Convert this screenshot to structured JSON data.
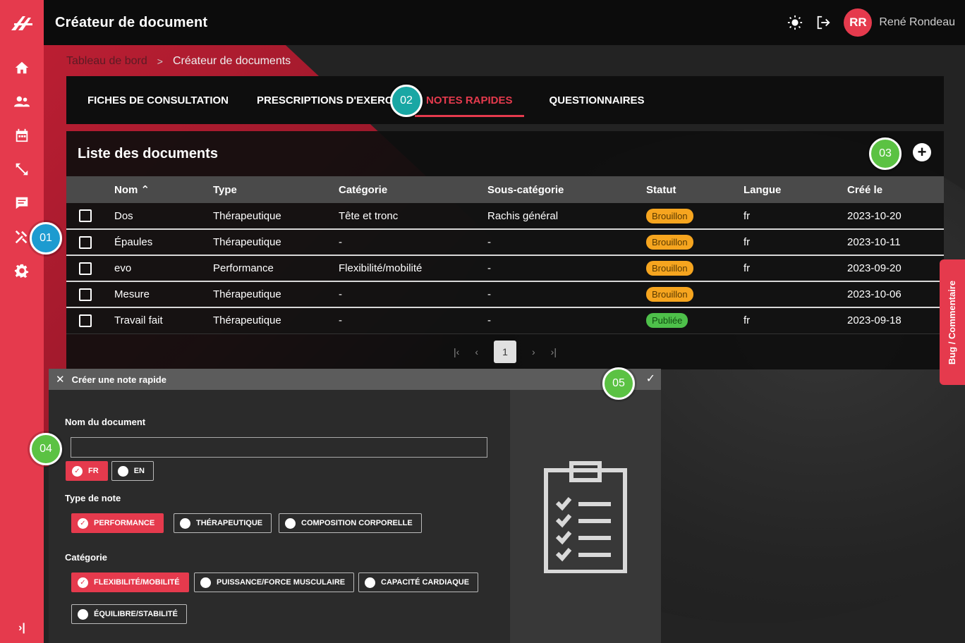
{
  "app": {
    "title": "Créateur de document"
  },
  "user": {
    "initials": "RR",
    "name": "René Rondeau"
  },
  "breadcrumb": {
    "previous": "Tableau de bord",
    "separator": ">",
    "current": "Créateur de documents"
  },
  "tabs": [
    {
      "label": "FICHES DE CONSULTATION"
    },
    {
      "label": "PRESCRIPTIONS D'EXERCICES"
    },
    {
      "label": "NOTES RAPIDES"
    },
    {
      "label": "QUESTIONNAIRES"
    }
  ],
  "markers": {
    "m1": "01",
    "m2": "02",
    "m3": "03",
    "m4": "04",
    "m5": "05"
  },
  "list": {
    "title": "Liste des documents",
    "add_label": "+",
    "columns": [
      "Nom ⌃",
      "Type",
      "Catégorie",
      "Sous-catégorie",
      "Statut",
      "Langue",
      "Créé le"
    ],
    "rows": [
      {
        "name": "Dos",
        "type": "Thérapeutique",
        "category": "Tête et tronc",
        "subcategory": "Rachis général",
        "status": "Brouillon",
        "lang": "fr",
        "created": "2023-10-20"
      },
      {
        "name": "Épaules",
        "type": "Thérapeutique",
        "category": "-",
        "subcategory": "-",
        "status": "Brouillon",
        "lang": "fr",
        "created": "2023-10-11"
      },
      {
        "name": "evo",
        "type": "Performance",
        "category": "Flexibilité/mobilité",
        "subcategory": "-",
        "status": "Brouillon",
        "lang": "fr",
        "created": "2023-09-20"
      },
      {
        "name": "Mesure",
        "type": "Thérapeutique",
        "category": "-",
        "subcategory": "-",
        "status": "Brouillon",
        "lang": "",
        "created": "2023-10-06"
      },
      {
        "name": "Travail fait",
        "type": "Thérapeutique",
        "category": "-",
        "subcategory": "-",
        "status": "Publiée",
        "lang": "fr",
        "created": "2023-09-18"
      }
    ],
    "pager": {
      "first": "|‹",
      "prev": "‹",
      "page": "1",
      "next": "›",
      "last": "›|"
    }
  },
  "quick_note": {
    "title": "Créer une note rapide",
    "close": "✕",
    "confirm": "✓",
    "name_label": "Nom du document",
    "name_value": "",
    "lang_fr": "FR",
    "lang_en": "EN",
    "type_label": "Type de note",
    "type_options": [
      "PERFORMANCE",
      "THÉRAPEUTIQUE",
      "COMPOSITION CORPORELLE"
    ],
    "category_label": "Catégorie",
    "category_options": [
      "FLEXIBILITÉ/MOBILITÉ",
      "PUISSANCE/FORCE MUSCULAIRE",
      "CAPACITÉ CARDIAQUE",
      "ÉQUILIBRE/STABILITÉ"
    ],
    "check": "✓"
  },
  "bug_tab": {
    "label": "Bug / Commentaire"
  },
  "sidebar": {
    "collapse": "›|"
  },
  "colors": {
    "accent": "#e53a4d",
    "draft": "#f6a51f",
    "published": "#4ec04a"
  }
}
